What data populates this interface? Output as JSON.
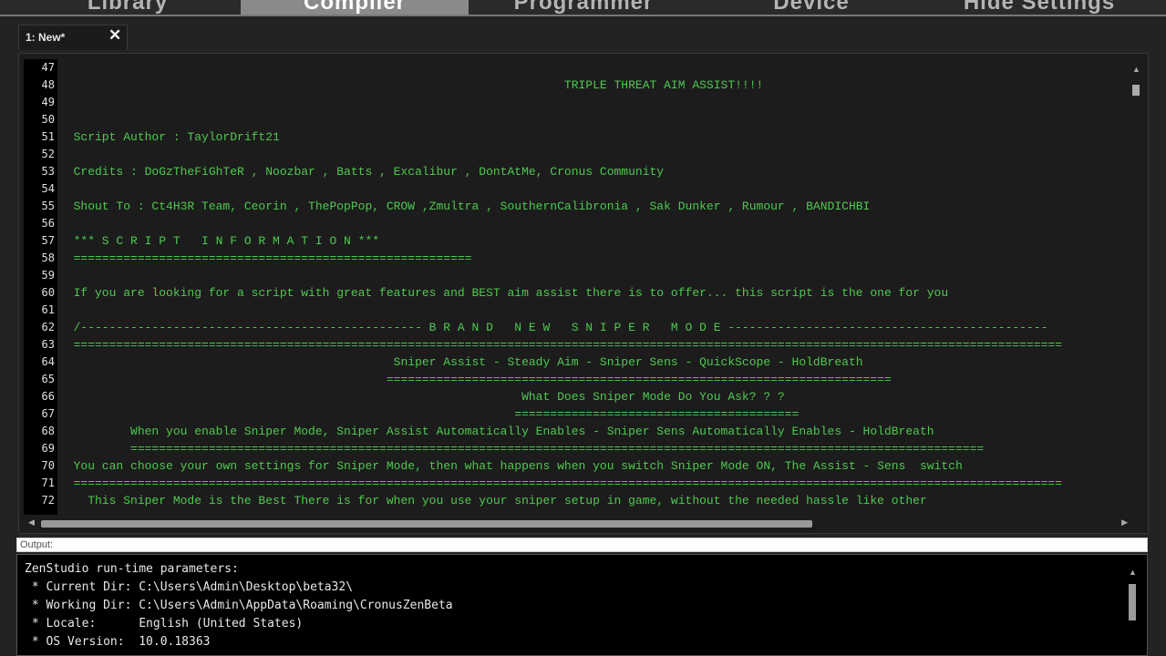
{
  "top_tabs": [
    "Library",
    "Compiler",
    "Programmer",
    "Device",
    "Hide Settings"
  ],
  "top_active": "Compiler",
  "doc_tab": {
    "label": "1: New*",
    "close": "✕"
  },
  "editor": {
    "line_numbers": [
      "47",
      "48",
      "49",
      "50",
      "51",
      "52",
      "53",
      "54",
      "55",
      "56",
      "57",
      "58",
      "59",
      "60",
      "61",
      "62",
      "63",
      "64",
      "65",
      "66",
      "67",
      "68",
      "69",
      "70",
      "71",
      "72"
    ],
    "lines": [
      "",
      "                                                                       TRIPLE THREAT AIM ASSIST!!!!",
      "",
      "",
      "  Script Author : TaylorDrift21",
      "",
      "  Credits : DoGzTheFiGhTeR , Noozbar , Batts , Excalibur , DontAtMe, Cronus Community",
      "",
      "  Shout To : Ct4H3R Team, Ceorin , ThePopPop, CROW ,Zmultra , SouthernCalibronia , Sak Dunker , Rumour , BANDICHBI",
      "",
      "  *** S C R I P T   I N F O R M A T I O N ***",
      "  ========================================================",
      "",
      "  If you are looking for a script with great features and BEST aim assist there is to offer... this script is the one for you",
      "",
      "  /------------------------------------------------ B R A N D   N E W   S N I P E R   M O D E ---------------------------------------------",
      "  ===========================================================================================================================================",
      "                                               Sniper Assist - Steady Aim - Sniper Sens - QuickScope - HoldBreath",
      "                                              =======================================================================",
      "                                                                 What Does Sniper Mode Do You Ask? ? ?",
      "                                                                ========================================",
      "          When you enable Sniper Mode, Sniper Assist Automatically Enables - Sniper Sens Automatically Enables - HoldBreath",
      "          ========================================================================================================================",
      "  You can choose your own settings for Sniper Mode, then what happens when you switch Sniper Mode ON, The Assist - Sens  switch",
      "  ===========================================================================================================================================",
      "    This Sniper Mode is the Best There is for when you use your sniper setup in game, without the needed hassle like other"
    ]
  },
  "output": {
    "label": "Output:",
    "lines": [
      "ZenStudio run-time parameters:",
      " * Current Dir: C:\\Users\\Admin\\Desktop\\beta32\\",
      " * Working Dir: C:\\Users\\Admin\\AppData\\Roaming\\CronusZenBeta",
      " * Locale:      English (United States)",
      " * OS Version:  10.0.18363"
    ]
  },
  "colors": {
    "code": "#50c850",
    "editor_bg": "#1c1c1c",
    "output_bg": "#000000"
  }
}
